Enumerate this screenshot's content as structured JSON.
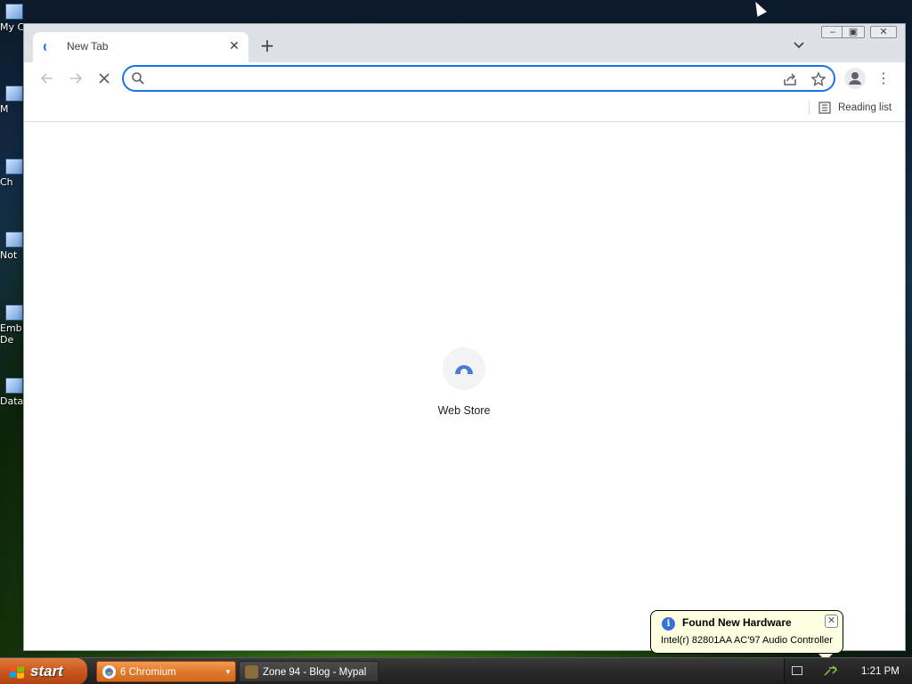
{
  "desktop": {
    "icons": [
      {
        "label": "My C"
      },
      {
        "label": "M"
      },
      {
        "label": "Ch"
      },
      {
        "label": "Not"
      },
      {
        "label": "Emb De"
      },
      {
        "label": "Data"
      }
    ]
  },
  "browser": {
    "tab": {
      "title": "New Tab"
    },
    "omnibox": {
      "value": "",
      "placeholder": ""
    },
    "bookmarks": {
      "reading_list_label": "Reading list"
    },
    "shortcut": {
      "label": "Web Store"
    }
  },
  "taskbar": {
    "start_label": "start",
    "tasks": [
      {
        "label": "6 Chromium"
      },
      {
        "label": "Zone 94 - Blog - Mypal"
      }
    ],
    "clock": "1:21 PM"
  },
  "notification": {
    "title": "Found New Hardware",
    "text": "Intel(r) 82801AA AC'97 Audio Controller"
  },
  "colors": {
    "accent": "#1a73e8",
    "taskbar_active": "#e07a2a",
    "balloon_bg": "#ffffe1"
  }
}
